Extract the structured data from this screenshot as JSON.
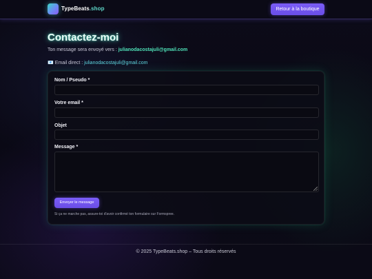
{
  "header": {
    "brand_name": "TypeBeats",
    "brand_domain": ".shop",
    "back_button": "Retour à la boutique"
  },
  "main": {
    "title": "Contactez-moi",
    "intro_text": "Ton message sera envoyé vers : ",
    "intro_email": "julianodacostajuli@gmail.com",
    "direct_icon": "📧",
    "direct_label": "Email direct : ",
    "direct_email": "julianodacostajuli@gmail.com"
  },
  "form": {
    "name_label": "Nom / Pseudo *",
    "name_value": "",
    "email_label": "Votre email *",
    "email_value": "",
    "subject_label": "Objet",
    "subject_value": "",
    "message_label": "Message *",
    "message_value": "",
    "submit_label": "Envoyer le message",
    "note": "Si ça ne marche pas, assure-toi d'avoir confirmé ton formulaire sur Formspree."
  },
  "footer": {
    "text": "© 2025 TypeBeats.shop – Tous droits réservés"
  },
  "colors": {
    "accent": "#6c51ef",
    "mint": "#4fe3b9",
    "background": "#0b0a16"
  }
}
